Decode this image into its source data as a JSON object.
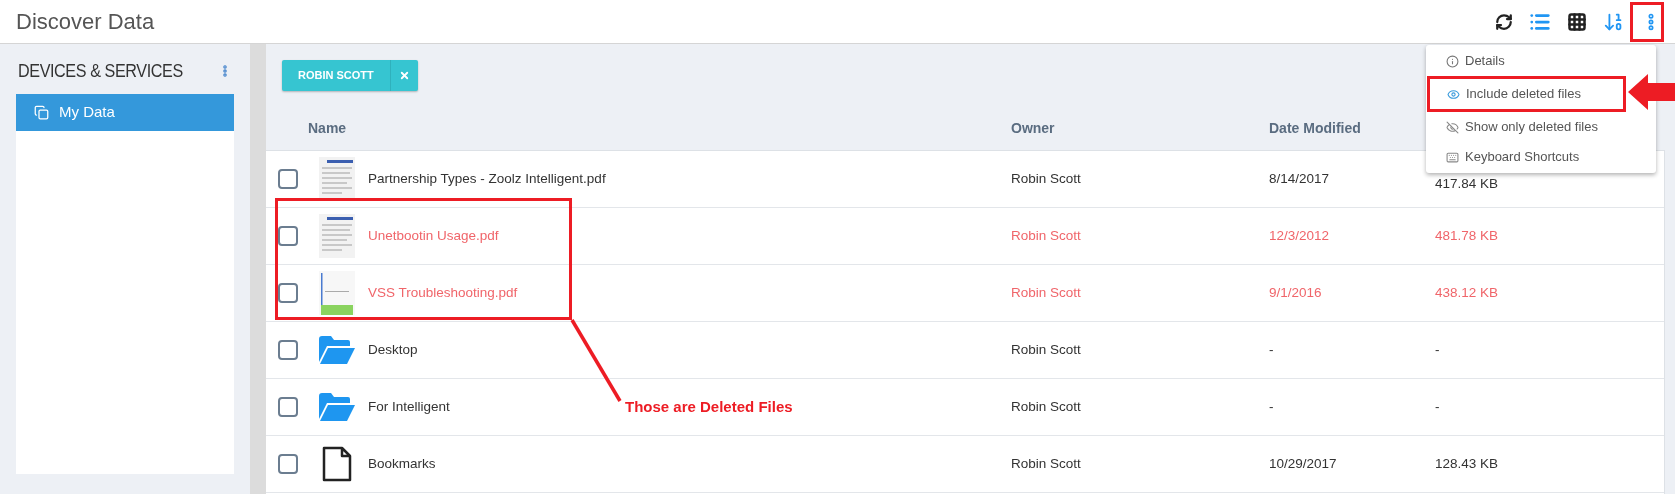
{
  "header": {
    "title": "Discover Data"
  },
  "sidebar": {
    "title": "DEVICES & SERVICES",
    "items": [
      {
        "label": "My Data",
        "selected": true
      }
    ]
  },
  "filter_tag": {
    "label": "ROBIN SCOTT"
  },
  "table": {
    "columns": [
      "Name",
      "Owner",
      "Date Modified"
    ],
    "rows": [
      {
        "kind": "doc",
        "name": "Partnership Types - Zoolz Intelligent.pdf",
        "owner": "Robin Scott",
        "date": "8/14/2017",
        "size": "417.84 KB",
        "deleted": false,
        "checked": false
      },
      {
        "kind": "doc",
        "name": "Unetbootin Usage.pdf",
        "owner": "Robin Scott",
        "date": "12/3/2012",
        "size": "481.78 KB",
        "deleted": true,
        "checked": false
      },
      {
        "kind": "doc2",
        "name": "VSS Troubleshooting.pdf",
        "owner": "Robin Scott",
        "date": "9/1/2016",
        "size": "438.12 KB",
        "deleted": true,
        "checked": false
      },
      {
        "kind": "folder",
        "name": "Desktop",
        "owner": "Robin Scott",
        "date": "-",
        "size": "-",
        "deleted": false,
        "checked": false
      },
      {
        "kind": "folder",
        "name": "For Intelligent",
        "owner": "Robin Scott",
        "date": "-",
        "size": "-",
        "deleted": false,
        "checked": false
      },
      {
        "kind": "file",
        "name": "Bookmarks",
        "owner": "Robin Scott",
        "date": "10/29/2017",
        "size": "128.43 KB",
        "deleted": false,
        "checked": false
      }
    ]
  },
  "menu": {
    "items": [
      {
        "label": "Details",
        "highlighted": false
      },
      {
        "label": "Include deleted files",
        "highlighted": true
      },
      {
        "label": "Show only deleted files",
        "highlighted": false
      },
      {
        "label": "Keyboard Shortcuts",
        "highlighted": false
      }
    ]
  },
  "annotation": {
    "text": "Those are Deleted Files"
  }
}
